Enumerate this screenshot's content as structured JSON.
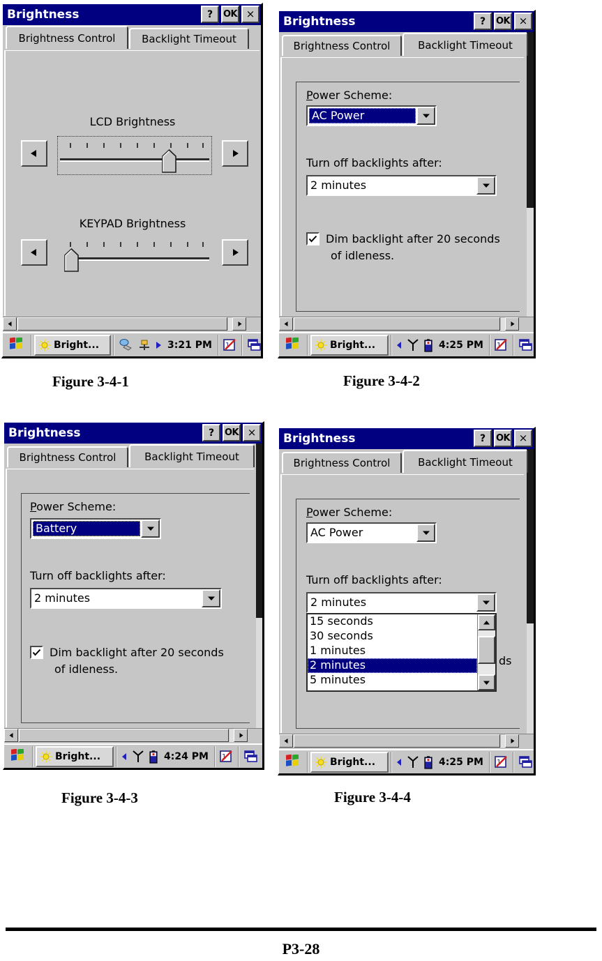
{
  "document": {
    "page_number": "P3-28",
    "captions": [
      "Figure 3-4-1",
      "Figure 3-4-2",
      "Figure 3-4-3",
      "Figure 3-4-4"
    ]
  },
  "colors": {
    "titlebar": "#000080",
    "face": "#c6c6c6",
    "highlight": "#000080",
    "highlight_text": "#ffffff",
    "text": "#000000"
  },
  "window_common": {
    "title": "Brightness",
    "help_button": "?",
    "ok_button": "OK",
    "close_button": "×",
    "tabs": [
      "Brightness Control",
      "Backlight Timeout"
    ]
  },
  "fig1": {
    "title": "Brightness",
    "active_tab": "Brightness Control",
    "lcd": {
      "label": "LCD Brightness",
      "value_percent": 72,
      "ticks": 9,
      "left_arrow": "◀",
      "right_arrow": "▶"
    },
    "keypad": {
      "label": "KEYPAD Brightness",
      "value_percent": 0,
      "ticks": 9,
      "left_arrow": "◀",
      "right_arrow": "▶"
    },
    "taskbar": {
      "task_label": "Bright...",
      "time": "3:21 PM",
      "tray_icons": [
        "network-connection-icon",
        "usb-plug-icon",
        "arrow-right-icon",
        "pen-pad-icon",
        "windows-switch-icon"
      ]
    }
  },
  "fig2": {
    "title": "Brightness",
    "active_tab": "Backlight Timeout",
    "power_scheme": {
      "label": "Power Scheme:",
      "label_accel": "P",
      "label_rest": "ower Scheme:",
      "value": "AC Power",
      "focused": true
    },
    "backlight_timeout": {
      "label": "Turn off backlights after:",
      "value": "2 minutes"
    },
    "dim_checkbox": {
      "checked": true,
      "line1": "Dim backlight after 20 seconds",
      "line2": "of idleness."
    },
    "taskbar": {
      "task_label": "Bright...",
      "time": "4:25 PM",
      "tray_icons": [
        "left-arrow-icon",
        "antenna-icon",
        "battery-icon",
        "pen-pad-icon",
        "windows-switch-icon"
      ]
    }
  },
  "fig3": {
    "title": "Brightness",
    "active_tab": "Backlight Timeout",
    "power_scheme": {
      "label": "Power Scheme:",
      "label_accel": "P",
      "label_rest": "ower Scheme:",
      "value": "Battery",
      "focused": true
    },
    "backlight_timeout": {
      "label": "Turn off backlights after:",
      "value": "2 minutes"
    },
    "dim_checkbox": {
      "checked": true,
      "line1": "Dim backlight after 20 seconds",
      "line2": "of idleness."
    },
    "taskbar": {
      "task_label": "Bright...",
      "time": "4:24 PM",
      "tray_icons": [
        "left-arrow-icon",
        "antenna-icon",
        "battery-icon",
        "pen-pad-icon",
        "windows-switch-icon"
      ]
    }
  },
  "fig4": {
    "title": "Brightness",
    "active_tab": "Backlight Timeout",
    "power_scheme": {
      "label": "Power Scheme:",
      "label_accel": "P",
      "label_rest": "ower Scheme:",
      "value": "AC Power",
      "focused": false
    },
    "backlight_timeout": {
      "label": "Turn off backlights after:",
      "value": "2 minutes",
      "dropdown_open": true,
      "options": [
        "15 seconds",
        "30 seconds",
        "1 minutes",
        "2 minutes",
        "5 minutes"
      ],
      "selected_option": "2 minutes",
      "selected_index": 3
    },
    "dim_checkbox_partial": "ds",
    "taskbar": {
      "task_label": "Bright...",
      "time": "4:25 PM",
      "tray_icons": [
        "left-arrow-icon",
        "antenna-icon",
        "battery-icon",
        "pen-pad-icon",
        "windows-switch-icon"
      ]
    }
  }
}
